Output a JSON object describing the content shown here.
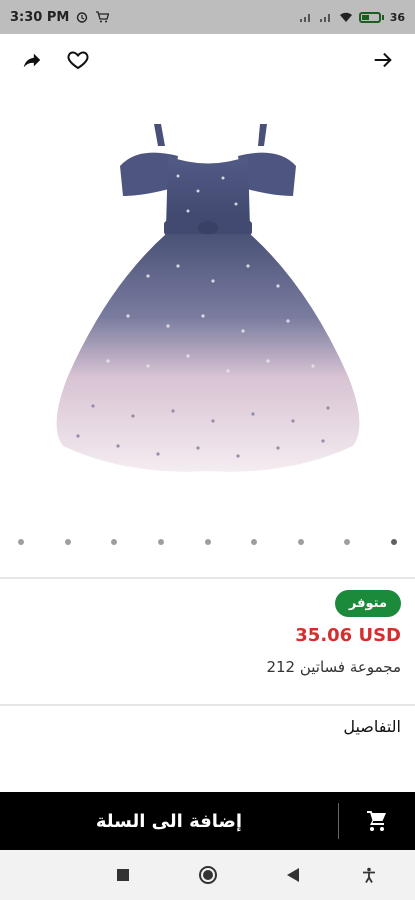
{
  "status_bar": {
    "time": "3:30 PM",
    "battery_level": "36"
  },
  "header": {
    "share_icon": "share-icon",
    "favorite_icon": "heart-outline-icon",
    "back_icon": "arrow-right-icon"
  },
  "gallery": {
    "dot_count": 9,
    "active_index": 8
  },
  "product": {
    "availability": "متوفر",
    "price": "35.06 USD",
    "collection": "مجموعة فساتين 212"
  },
  "details": {
    "title": "التفاصيل"
  },
  "cart": {
    "add_label": "إضافة الى السلة",
    "icon": "cart-icon"
  },
  "colors": {
    "availability_badge": "#1b8a3a",
    "price": "#d32f2f",
    "cart_bar": "#000000"
  }
}
